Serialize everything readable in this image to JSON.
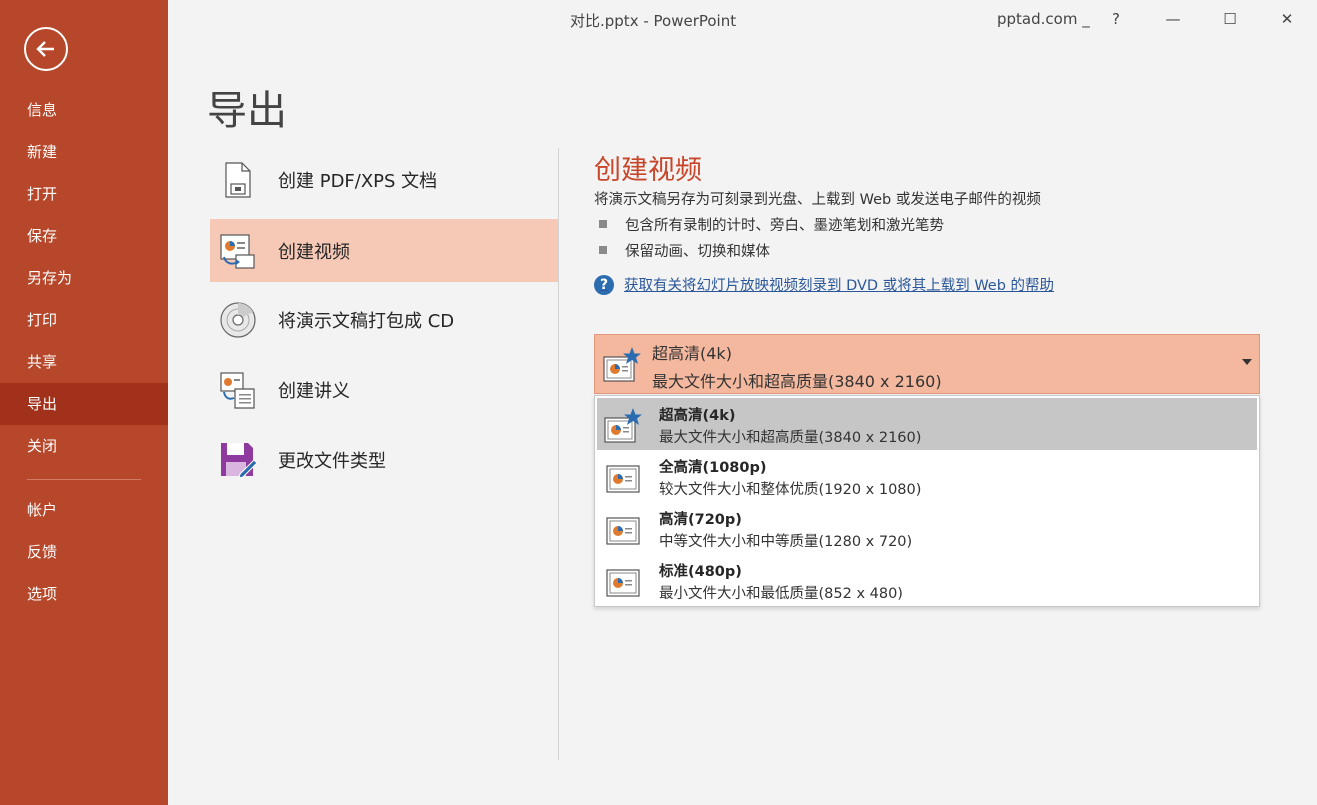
{
  "window": {
    "title": "对比.pptx  -  PowerPoint",
    "account": "pptad.com _",
    "help": "?",
    "minimize": "—",
    "maximize": "☐",
    "close": "✕"
  },
  "sidebar": {
    "items": [
      {
        "label": "信息"
      },
      {
        "label": "新建"
      },
      {
        "label": "打开"
      },
      {
        "label": "保存"
      },
      {
        "label": "另存为"
      },
      {
        "label": "打印"
      },
      {
        "label": "共享"
      },
      {
        "label": "导出",
        "active": true
      },
      {
        "label": "关闭"
      },
      {
        "label": "帐户"
      },
      {
        "label": "反馈"
      },
      {
        "label": "选项"
      }
    ]
  },
  "page": {
    "title": "导出"
  },
  "options": [
    {
      "label": "创建 PDF/XPS 文档",
      "icon": "pdf-document-icon"
    },
    {
      "label": "创建视频",
      "icon": "video-icon",
      "selected": true
    },
    {
      "label": "将演示文稿打包成 CD",
      "icon": "cd-icon"
    },
    {
      "label": "创建讲义",
      "icon": "handout-icon"
    },
    {
      "label": "更改文件类型",
      "icon": "file-type-icon"
    }
  ],
  "detail": {
    "title": "创建视频",
    "description": "将演示文稿另存为可刻录到光盘、上载到 Web 或发送电子邮件的视频",
    "bullets": [
      "包含所有录制的计时、旁白、墨迹笔划和激光笔势",
      "保留动画、切换和媒体"
    ],
    "help_icon": "?",
    "help_link": "获取有关将幻灯片放映视频刻录到 DVD 或将其上载到 Web 的帮助"
  },
  "quality_dropdown": {
    "selected_name": "超高清(4k)",
    "selected_desc": "最大文件大小和超高质量(3840 x 2160)",
    "options": [
      {
        "name": "超高清(4k)",
        "desc": "最大文件大小和超高质量(3840 x 2160)",
        "highlighted": true
      },
      {
        "name": "全高清(1080p)",
        "desc": "较大文件大小和整体优质(1920 x 1080)"
      },
      {
        "name": "高清(720p)",
        "desc": "中等文件大小和中等质量(1280 x 720)"
      },
      {
        "name": "标准(480p)",
        "desc": "最小文件大小和最低质量(852 x 480)"
      }
    ]
  },
  "colors": {
    "sidebar": "#b7472a",
    "sidebar_active": "#a1311a",
    "accent_title": "#c8462a",
    "selection": "#f6c9b6",
    "link": "#2b579a"
  }
}
